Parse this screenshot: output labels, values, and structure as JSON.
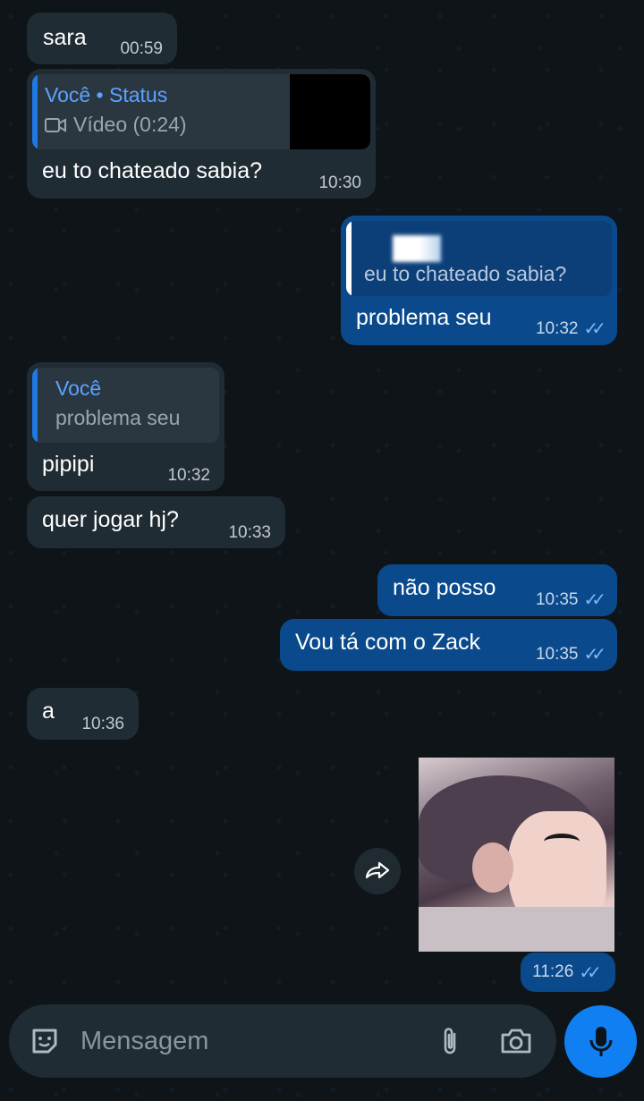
{
  "messages": [
    {
      "dir": "in",
      "text": "sara",
      "time": "00:59"
    },
    {
      "dir": "in",
      "reply_author": "Você • Status",
      "reply_text": "Vídeo (0:24)",
      "text": "eu to chateado sabia?",
      "time": "10:30"
    },
    {
      "dir": "out",
      "reply_text": "eu to chateado sabia?",
      "text": "problema seu",
      "time": "10:32"
    },
    {
      "dir": "in",
      "reply_author": "Você",
      "reply_text": "problema seu",
      "text": "pipipi",
      "time": "10:32"
    },
    {
      "dir": "in",
      "text": "quer jogar hj?",
      "time": "10:33"
    },
    {
      "dir": "out",
      "text": "não posso",
      "time": "10:35"
    },
    {
      "dir": "out",
      "text": "Vou tá com o Zack",
      "time": "10:35"
    },
    {
      "dir": "in",
      "text": "a",
      "time": "10:36"
    }
  ],
  "image_message": {
    "time": "11:26"
  },
  "composer": {
    "placeholder": "Mensagem"
  },
  "icons": {
    "video": "video-icon",
    "read_ticks": "double-check-icon",
    "forward": "forward-icon",
    "sticker": "sticker-icon",
    "attach": "paperclip-icon",
    "camera": "camera-icon",
    "mic": "mic-icon"
  },
  "colors": {
    "incoming": "#202c33",
    "outgoing": "#0a4a8c",
    "accent": "#0f7ff2",
    "quote_author": "#5aa3ff"
  }
}
